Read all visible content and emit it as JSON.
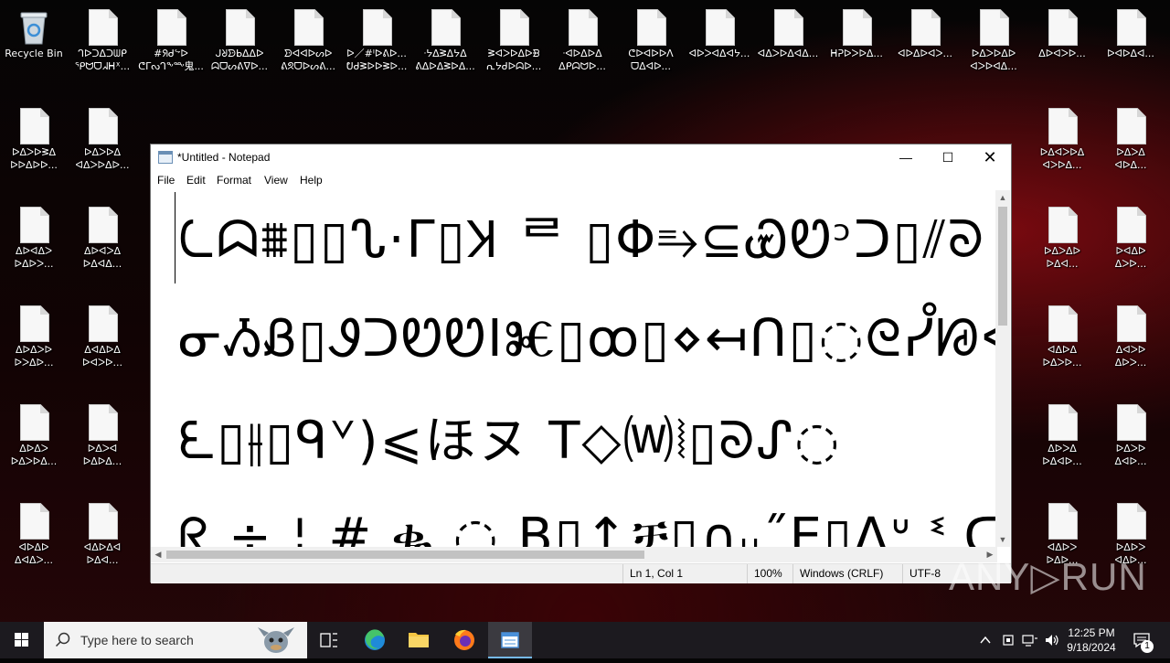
{
  "desktop": {
    "recycle_bin_label": "Recycle Bin",
    "icons_row1": [
      "ᒉᐅᑐᐃᑐᗯᑭ\nᕿᗢᗜᖽᕼᕁ...",
      "#ᖆᑯᖦᐅ\nᕦᒥᔓᒉᖕᖖ鬼...",
      "ᒍᖈᗦᖯᐃᐃᐅ\nᗣᗜᔕᕕᐁᐅ...",
      "ᗦᐊᐊᐅᔕᐅ\nᕕᘝᗜᐅᔕᕕ...",
      "ᐅ／#ᑊᐅᕕᐅ...\nᕞᑯᕒᐅᐅᕒᐅ...",
      "ᐧᔭᐃᕒᐃᔭᐃ\nᕕᐃᐅᐃᕒᐅᐃ...",
      "ᕒᐊᐳᐅᐃᐅᗽ\nᕆᔭᑯᐅᗣᐅ...",
      "ᐧᐊᐅᐃᐅᐃ\nᐃᑭᗣᗢᐅ...",
      "ᕦᐅᐊᐅᐅᐱ\nᗜᐃᐊᐅ...",
      "ᐊᐅᐳᐊᐃᐊᔭ...",
      "ᐊᐃᐳᐅᐃᐊᐃ...",
      "ᕼᕈᐅᐳᐅᐃ...",
      "ᐊᐅᐃᐅᐊᐳ...",
      "ᐅᐃᐳᐅᐃᐅ\nᐊᐳᐅᐊᐃ...",
      "ᐃᐅᐊᐳᐅ...",
      "ᐅᐊᐅᐃᐊ..."
    ],
    "icons_left": [
      "ᐅᐃᐳᐅᕒᐃ\nᐅᐅᐃᐅᐅ...",
      "ᐅᐃᐳᐅᐃ\nᐊᐃᐳᐅᐃᐅ...",
      "ᐃᐅᐊᐃᐳ\nᐅᐃᐅᐳ...",
      "ᐃᐅᐊᐳᐃ\nᐅᐃᐊᐃ...",
      "ᐃᐅᐃᐳᐅ\nᐅᐳᐃᐅ...",
      "ᐃᐊᐃᐅᐃ\nᐅᐊᐳᐅ...",
      "ᐃᐅᐃᐳ\nᐅᐃᐳᐅᐃ...",
      "ᐅᐃᐳᐊ\nᐅᐃᐅᐃ...",
      "ᐊᐅᐃᐅ\nᐃᐊᐃᐳ...",
      "ᐊᐃᐅᐃᐊ\nᐅᐃᐊ..."
    ],
    "icons_right": [
      "ᐅᐃᐊᐳᐅᐃ\nᐊᐳᐅᐃ...",
      "ᐅᐃᐳᐃ\nᐊᐅᐃ...",
      "ᐅᐃᐳᐃᐅ\nᐅᐃᐊ...",
      "ᐅᐊᐃᐅ\nᐃᐳᐅ...",
      "ᐊᐃᐅᐃ\nᐅᐃᐳᐅ...",
      "ᐃᐊᐳᐅ\nᐃᐅᐳ...",
      "ᐃᐅᐳᐃ\nᐅᐃᐊᐅ...",
      "ᐅᐃᐳᐅ\nᐃᐊᐅ...",
      "ᐊᐃᐅᐳ\nᐅᐃᐅ...",
      "ᐅᐃᐅᐳ\nᐊᐃᐅ..."
    ]
  },
  "notepad": {
    "title": "*Untitled - Notepad",
    "menu": [
      "File",
      "Edit",
      "Format",
      "View",
      "Help"
    ],
    "lines": [
      "ᘇᗣ⩩▯▯ᔐ·Γ▯Ʞ ᄅ ▯Φ⥱⊆ᏯᏬᵓᑐ▯⫽ᘐ",
      "ᓂᏱᏰ▯ᏭᑐᏬᏬIⰨ▯ꝏ▯⋄↤ᑎ▯◌ᘓᓮᘘᐸ—Ꮖ",
      "ᘍ▯⫲▯ᑫᘁ)⩽ほヌ Т◇⒲⦚▯ᘐᔑ◌",
      "ᖇ ÷ ¦ # ቈ ◌ B▯↑ቻ▯∩ᵤ˝E▯ᐱᐡ ᓫ ᑕ Γ"
    ],
    "status": {
      "position": "Ln 1, Col 1",
      "zoom": "100%",
      "line_ending": "Windows (CRLF)",
      "encoding": "UTF-8"
    }
  },
  "taskbar": {
    "search_placeholder": "Type here to search",
    "time": "12:25 PM",
    "date": "9/18/2024",
    "notification_count": "1"
  },
  "watermark": "ANY▷RUN",
  "colors": {
    "taskbar_bg": "#1c1a1f",
    "accent": "#0078d4"
  }
}
